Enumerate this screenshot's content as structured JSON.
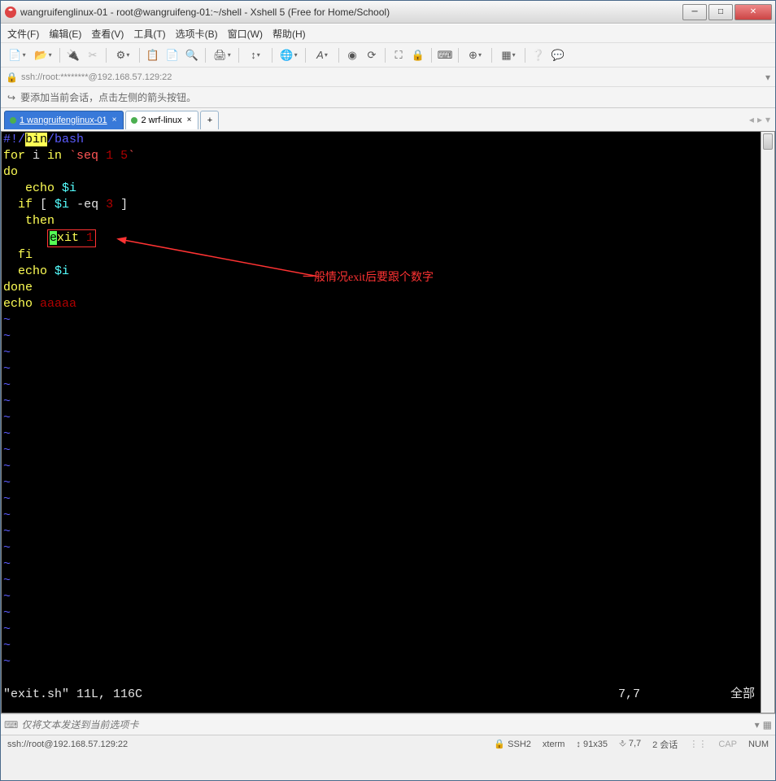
{
  "window": {
    "title": "wangruifenglinux-01 - root@wangruifeng-01:~/shell - Xshell 5 (Free for Home/School)"
  },
  "menu": {
    "file": "文件(F)",
    "edit": "编辑(E)",
    "view": "查看(V)",
    "tools": "工具(T)",
    "tabs": "选项卡(B)",
    "window": "窗口(W)",
    "help": "帮助(H)"
  },
  "address": {
    "text": "ssh://root:********@192.168.57.129:22"
  },
  "tip": {
    "text": "要添加当前会话，点击左侧的箭头按钮。"
  },
  "tabs": {
    "items": [
      {
        "label": "1 wangruifenglinux-01",
        "active": true
      },
      {
        "label": "2 wrf-linux",
        "active": false
      }
    ]
  },
  "editor": {
    "lines": {
      "l1_a": "#!/",
      "l1_b": "bin",
      "l1_c": "/bash",
      "l2_a": "for",
      "l2_b": " i ",
      "l2_c": "in",
      "l2_d": " `seq ",
      "l2_e": "1 5",
      "l2_f": "`",
      "l3": "do",
      "l4_a": "   echo ",
      "l4_b": "$i",
      "l5_a": "  ",
      "l5_b": "if",
      "l5_c": " [ ",
      "l5_d": "$i",
      "l5_e": " -eq ",
      "l5_f": "3",
      "l5_g": " ]",
      "l6_a": "   ",
      "l6_b": "then",
      "l7_pad": "      ",
      "l7_cur": "e",
      "l7_a": "xit",
      "l7_b": " 1",
      "l8_a": "  ",
      "l8_b": "fi",
      "l9_a": "  echo ",
      "l9_b": "$i",
      "l10": "done",
      "l11_a": "echo",
      "l11_b": " aaaaa",
      "tilde": "~"
    },
    "status": {
      "left": "\"exit.sh\" 11L, 116C",
      "mid": "7,7",
      "right": "全部"
    },
    "annotation": "一般情况exit后要跟个数字"
  },
  "inputbar": {
    "placeholder": "仅将文本发送到当前选项卡"
  },
  "status": {
    "left": "ssh://root@192.168.57.129:22",
    "ssh": "SSH2",
    "term": "xterm",
    "size": "91x35",
    "pos": "7,7",
    "sessions": "2 会话",
    "cap": "CAP",
    "num": "NUM"
  }
}
